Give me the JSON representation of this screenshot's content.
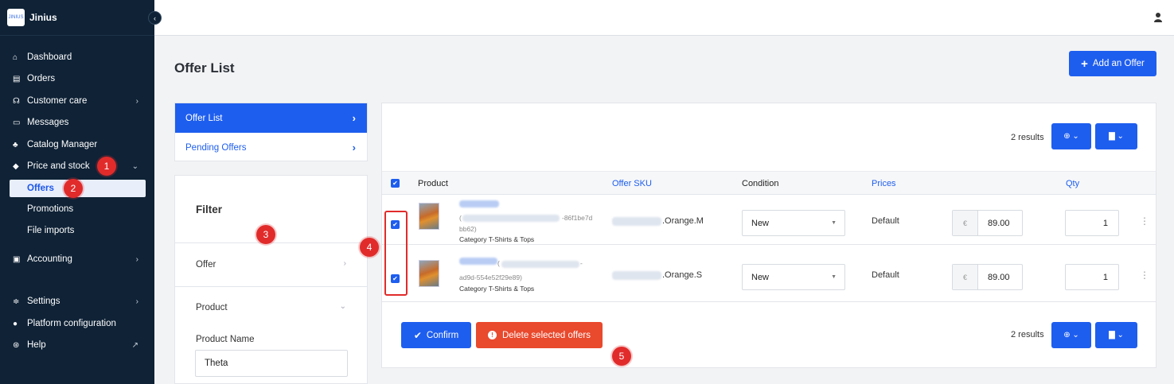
{
  "app": {
    "logo_text": "JINIUS",
    "name": "Jinius"
  },
  "sidebar": {
    "items": [
      {
        "label": "Dashboard",
        "icon": "home-icon"
      },
      {
        "label": "Orders",
        "icon": "clipboard-icon"
      },
      {
        "label": "Customer care",
        "icon": "headset-icon"
      },
      {
        "label": "Messages",
        "icon": "message-icon"
      },
      {
        "label": "Catalog Manager",
        "icon": "sitemap-icon"
      },
      {
        "label": "Price and stock",
        "icon": "tag-icon"
      },
      {
        "label": "Accounting",
        "icon": "ledger-icon"
      },
      {
        "label": "Settings",
        "icon": "sliders-icon"
      },
      {
        "label": "Platform configuration",
        "icon": "info-icon"
      },
      {
        "label": "Help",
        "icon": "lifebuoy-icon"
      }
    ],
    "sub_items": [
      {
        "label": "Offers"
      },
      {
        "label": "Promotions"
      },
      {
        "label": "File imports"
      }
    ]
  },
  "page": {
    "title": "Offer List",
    "add_button": "Add an Offer"
  },
  "tabs": [
    {
      "label": "Offer List"
    },
    {
      "label": "Pending Offers"
    }
  ],
  "filter": {
    "title": "Filter",
    "sections": [
      {
        "label": "Offer"
      },
      {
        "label": "Product"
      }
    ],
    "product_name_label": "Product Name",
    "product_name_value": "Theta"
  },
  "table": {
    "results": "2 results",
    "columns": [
      "Product",
      "Offer SKU",
      "Condition",
      "Prices",
      "Qty"
    ],
    "rows": [
      {
        "id_fragment": "-86f1be7d",
        "id_fragment2": "bb62)",
        "category": "Category T-Shirts & Tops",
        "sku_suffix": ".Orange.M",
        "condition": "New",
        "price_label": "Default",
        "currency": "€",
        "price": "89.00",
        "qty": "1"
      },
      {
        "id_fragment": "-",
        "id_fragment2": "ad9d-554e52f29e89)",
        "category": "Category T-Shirts & Tops",
        "sku_suffix": ".Orange.S",
        "condition": "New",
        "price_label": "Default",
        "currency": "€",
        "price": "89.00",
        "qty": "1"
      }
    ]
  },
  "actions": {
    "confirm": "Confirm",
    "delete": "Delete selected offers"
  },
  "annotations": [
    "1",
    "2",
    "3",
    "4",
    "5"
  ],
  "colors": {
    "primary": "#1e5eef",
    "danger": "#e9492d",
    "sidebar": "#0f2236",
    "annotation": "#e12b2b"
  }
}
